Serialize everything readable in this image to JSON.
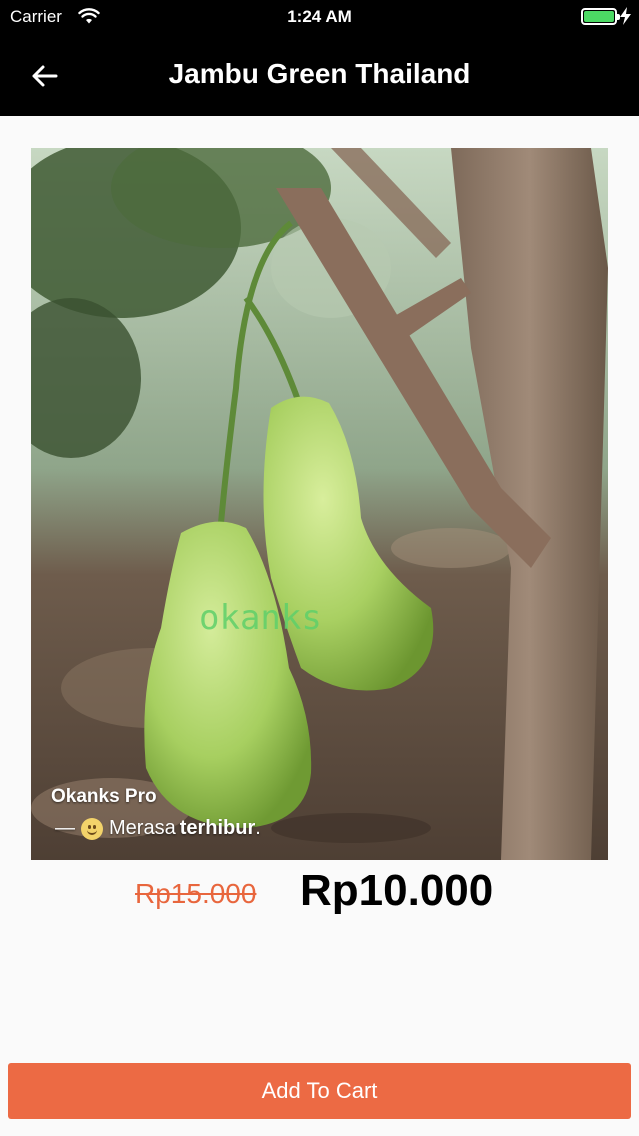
{
  "status_bar": {
    "carrier": "Carrier",
    "time": "1:24 AM",
    "battery_color": "#4cd964"
  },
  "nav": {
    "back_icon": "arrow-left-icon",
    "title": "Jambu Green Thailand"
  },
  "product": {
    "image": {
      "subject": "two green water apples hanging from a tree branch",
      "watermark": "okanks",
      "caption_user": "Okanks Pro",
      "caption_status": "— ",
      "caption_status_word": "Merasa",
      "caption_status_bold": "terhibur",
      "caption_status_end": "."
    },
    "old_price": "Rp15.000",
    "new_price": "Rp10.000"
  },
  "actions": {
    "add_to_cart_label": "Add To Cart",
    "accent_color": "#ec6a44"
  }
}
